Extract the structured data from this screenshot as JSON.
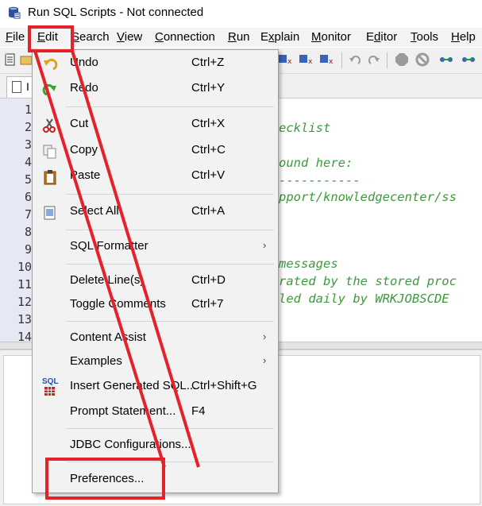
{
  "window": {
    "title": "Run SQL Scripts - Not connected"
  },
  "menubar": {
    "items": [
      {
        "pre": "",
        "ul": "F",
        "post": "ile"
      },
      {
        "pre": "",
        "ul": "E",
        "post": "dit"
      },
      {
        "pre": "",
        "ul": "S",
        "post": "earch"
      },
      {
        "pre": "",
        "ul": "V",
        "post": "iew"
      },
      {
        "pre": "",
        "ul": "C",
        "post": "onnection"
      },
      {
        "pre": "",
        "ul": "R",
        "post": "un"
      },
      {
        "pre": "E",
        "ul": "x",
        "post": "plain"
      },
      {
        "pre": "",
        "ul": "M",
        "post": "onitor"
      },
      {
        "pre": "E",
        "ul": "d",
        "post": "itor"
      },
      {
        "pre": "",
        "ul": "T",
        "post": "ools"
      },
      {
        "pre": "",
        "ul": "H",
        "post": "elp"
      }
    ]
  },
  "tabs": [
    {
      "label": "I"
    }
  ],
  "editor": {
    "line_numbers": [
      "1",
      "2",
      "3",
      "4",
      "5",
      "6",
      "7",
      "8",
      "9",
      "10",
      "11",
      "12",
      "13",
      "14"
    ],
    "code_fragments": [
      "ecklist",
      "ound here:",
      "-----------",
      "pport/knowledgecenter/ss",
      "messages",
      "rated by the stored proc",
      "led daily by WRKJOBSCDE"
    ]
  },
  "edit_menu": {
    "undo": {
      "label": "Undo",
      "shortcut": "Ctrl+Z"
    },
    "redo": {
      "label": "Redo",
      "shortcut": "Ctrl+Y"
    },
    "cut": {
      "label": "Cut",
      "shortcut": "Ctrl+X"
    },
    "copy": {
      "label": "Copy",
      "shortcut": "Ctrl+C"
    },
    "paste": {
      "label": "Paste",
      "shortcut": "Ctrl+V"
    },
    "select_all": {
      "label": "Select All",
      "shortcut": "Ctrl+A"
    },
    "sql_formatter": {
      "label": "SQL Formatter"
    },
    "delete_lines": {
      "label": "Delete Line(s)",
      "shortcut": "Ctrl+D"
    },
    "toggle_comments": {
      "label": "Toggle Comments",
      "shortcut": "Ctrl+7"
    },
    "content_assist": {
      "label": "Content Assist"
    },
    "examples": {
      "label": "Examples"
    },
    "insert_generated_sql": {
      "label": "Insert Generated SQL...",
      "shortcut": "Ctrl+Shift+G",
      "icon_text": "SQL"
    },
    "prompt_statement": {
      "label": "Prompt Statement...",
      "shortcut": "F4"
    },
    "jdbc_configurations": {
      "label": "JDBC Configurations..."
    },
    "preferences": {
      "label": "Preferences..."
    },
    "submenu_arrow": "›"
  },
  "colors": {
    "annotation_red": "#e4222a",
    "comment_green": "#3c9a3c",
    "menu_bg": "#f2f2f2"
  }
}
